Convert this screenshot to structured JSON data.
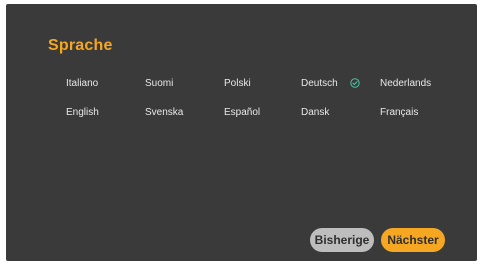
{
  "screen": {
    "title": "Sprache"
  },
  "languages": {
    "row1": [
      "Italiano",
      "Suomi",
      "Polski",
      "Deutsch",
      "Nederlands"
    ],
    "row2": [
      "English",
      "Svenska",
      "Español",
      "Dansk",
      "Français"
    ],
    "selected": "Deutsch"
  },
  "buttons": {
    "previous_label": "Bisherige",
    "next_label": "Nächster"
  },
  "icons": {
    "selected_indicator": "check-circle-icon"
  },
  "colors": {
    "background": "#3a3a3a",
    "accent": "#f5a722",
    "secondary_button": "#bdbdbd",
    "text": "#e8e8e8"
  }
}
